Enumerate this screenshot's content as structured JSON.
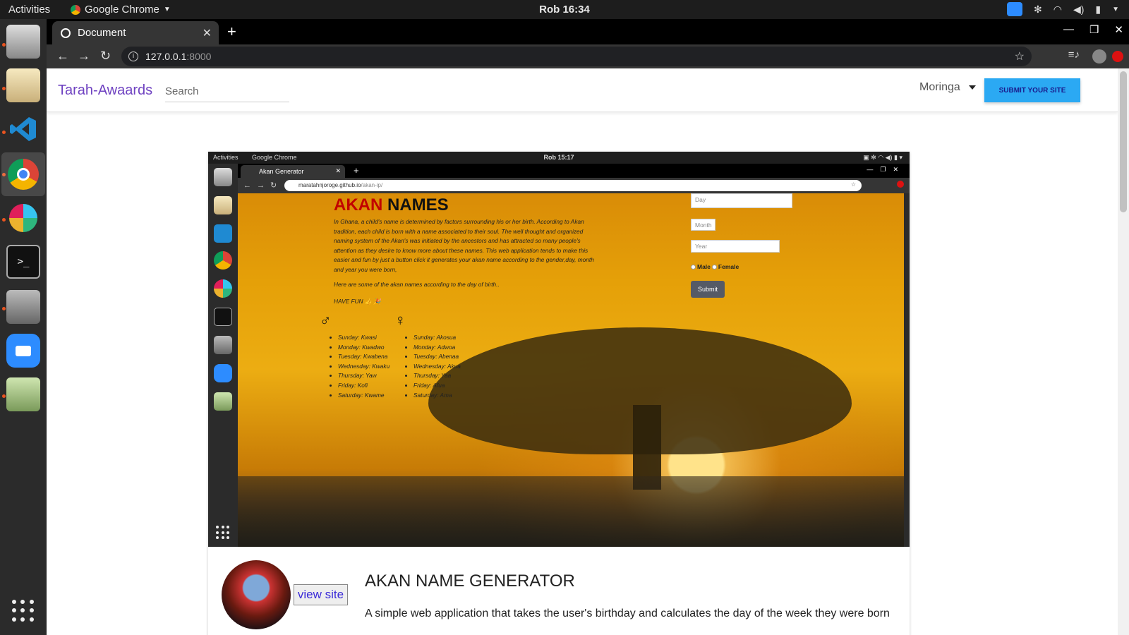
{
  "system": {
    "activities": "Activities",
    "app_name": "Google Chrome",
    "clock": "Rob 16:34"
  },
  "browser": {
    "tab_title": "Document",
    "url_host": "127.0.0.1",
    "url_port": ":8000"
  },
  "site": {
    "brand": "Tarah-Awaards",
    "search_placeholder": "Search",
    "user": "Moringa",
    "submit_button": "SUBMIT YOUR SITE",
    "colors": {
      "brand": "#6f42c1",
      "submit_bg": "#2ba9f3"
    }
  },
  "screenshot": {
    "activities": "Activities",
    "app_name": "Google Chrome",
    "clock": "Rob 15:17",
    "tab_title": "Akan Generator",
    "url_host": "maratahnjoroge.github.io",
    "url_path": "/akan-ip/",
    "heading_red": "AKAN",
    "heading_black": "NAMES",
    "description": "In Ghana, a child's name is determined by factors surrounding his or her birth. According to Akan tradition, each child is born with a name associated to their soul. The well thought and organized naming system of the Akan's was initiated by the ancestors and has attracted so many people's attention as they desire to know more about these names. This web application tends to make this easier and fun by just a button click it generates your akan name according to the gender,day, month and year you were born,",
    "description2": "Here are some of the akan names according to the day of birth..",
    "fun": "HAVE FUN 👍 🎉",
    "male_symbol": "♂",
    "female_symbol": "♀",
    "male_names": [
      "Sunday: Kwasi",
      "Monday: Kwadwo",
      "Tuesday: Kwabena",
      "Wednesday: Kwaku",
      "Thursday: Yaw",
      "Friday: Kofi",
      "Saturday: Kwame"
    ],
    "female_names": [
      "Sunday: Akosua",
      "Monday: Adwoa",
      "Tuesday: Abenaa",
      "Wednesday: Akua",
      "Thursday: Yaa",
      "Friday: Afua",
      "Saturday: Ama"
    ],
    "form": {
      "day_placeholder": "Day",
      "month_placeholder": "Month",
      "year_placeholder": "Year",
      "male": "Male",
      "female": "Female",
      "submit": "Submit"
    }
  },
  "project": {
    "view_site": "view site",
    "title": "AKAN NAME GENERATOR",
    "description": "A simple web application that takes the user's birthday and calculates the day of the week they were born"
  }
}
